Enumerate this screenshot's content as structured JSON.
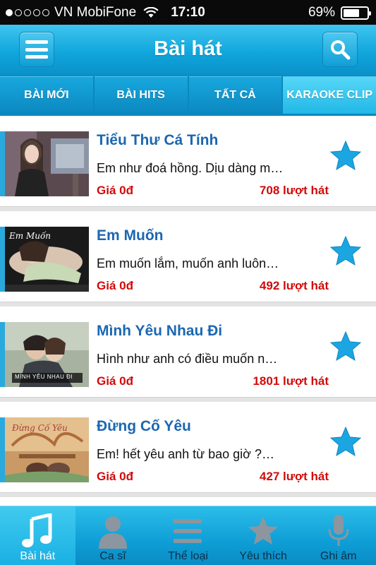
{
  "status": {
    "carrier": "VN MobiFone",
    "time": "17:10",
    "battery": "69%",
    "battery_level": 0.69,
    "signal_bars": 1
  },
  "header": {
    "title": "Bài hát"
  },
  "tabs": [
    {
      "label": "BÀI MỚI",
      "active": false
    },
    {
      "label": "BÀI HITS",
      "active": false
    },
    {
      "label": "TẤT CẢ",
      "active": false
    },
    {
      "label": "KARAOKE CLIP",
      "active": true
    }
  ],
  "songs": [
    {
      "title": "Tiểu Thư Cá Tính",
      "lyric": "Em như đoá hồng. Dịu dàng m…",
      "price": "Giá 0đ",
      "plays": "708 lượt hát",
      "thumb_caption": ""
    },
    {
      "title": "Em Muốn",
      "lyric": "Em muốn lắm, muốn anh luôn…",
      "price": "Giá 0đ",
      "plays": "492 lượt hát",
      "thumb_caption": "Em Muốn"
    },
    {
      "title": "Mình Yêu Nhau Đi",
      "lyric": "Hình như anh có điều muốn n…",
      "price": "Giá 0đ",
      "plays": "1801 lượt hát",
      "thumb_caption": "MÌNH YÊU NHAU ĐI"
    },
    {
      "title": "Đừng Cố Yêu",
      "lyric": "Em! hết yêu anh từ bao giờ ?…",
      "price": "Giá 0đ",
      "plays": "427 lượt hát",
      "thumb_caption": "Đừng Cố Yêu"
    }
  ],
  "tabbar": [
    {
      "label": "Bài hát",
      "icon": "music-note-icon",
      "active": true
    },
    {
      "label": "Ca sĩ",
      "icon": "person-icon",
      "active": false
    },
    {
      "label": "Thể loại",
      "icon": "list-icon",
      "active": false
    },
    {
      "label": "Yêu thích",
      "icon": "star-icon",
      "active": false
    },
    {
      "label": "Ghi âm",
      "icon": "microphone-icon",
      "active": false
    }
  ],
  "colors": {
    "accent": "#10a6dc",
    "title_blue": "#1b67b1",
    "price_red": "#d10a0a",
    "star": "#1ba6e2"
  }
}
